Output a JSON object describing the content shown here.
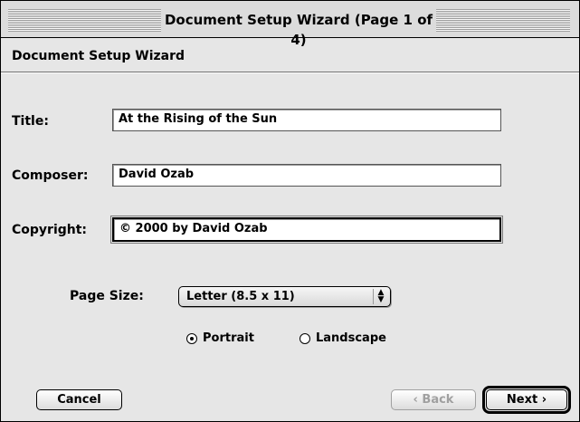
{
  "window": {
    "title": "Document Setup Wizard (Page 1 of 4)"
  },
  "header": {
    "title": "Document Setup Wizard"
  },
  "form": {
    "title_label": "Title:",
    "title_value": "At the Rising of the Sun",
    "composer_label": "Composer:",
    "composer_value": "David Ozab",
    "copyright_label": "Copyright:",
    "copyright_value": "© 2000 by David Ozab",
    "page_size_label": "Page Size:",
    "page_size_value": "Letter (8.5 x 11)",
    "orientation": {
      "portrait_label": "Portrait",
      "landscape_label": "Landscape",
      "selected": "Portrait"
    }
  },
  "buttons": {
    "cancel": "Cancel",
    "back": "‹ Back",
    "next": "Next ›"
  }
}
